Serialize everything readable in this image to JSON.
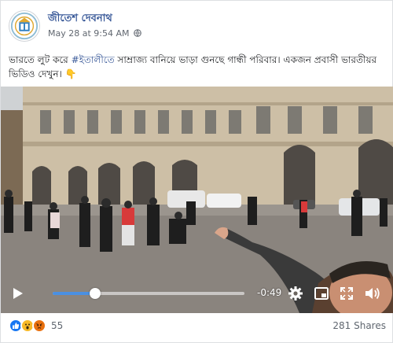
{
  "post": {
    "author": "জীতেশ দেবনাথ",
    "timestamp": "May 28 at 9:54 AM",
    "text_part1": "ভারতে লুট করে ",
    "hashtag": "#ইতালীতে",
    "text_part2": " সাম্রাজ্য বানিয়ে ভাড়া গুনছে গান্ধী পরিবার। একজন প্রবাসী ভারতীয়র ভিডিও দেখুন। 👇"
  },
  "video": {
    "time_remaining": "-0:49",
    "progress": 0.22
  },
  "footer": {
    "reaction_count": "55",
    "shares": "281 Shares",
    "reactions": [
      "like",
      "wow",
      "angry"
    ]
  },
  "icons": {
    "globe": "globe-icon",
    "play": "play-icon",
    "settings": "gear-icon",
    "fullscreen": "fullscreen-icon",
    "volume": "volume-icon",
    "pip": "pip-icon"
  },
  "colors": {
    "link_blue": "#385898",
    "progress_blue": "#4a90e2",
    "like_blue": "#1877f2",
    "wow_yellow": "#f7b928",
    "angry_orange": "#e9710f"
  }
}
